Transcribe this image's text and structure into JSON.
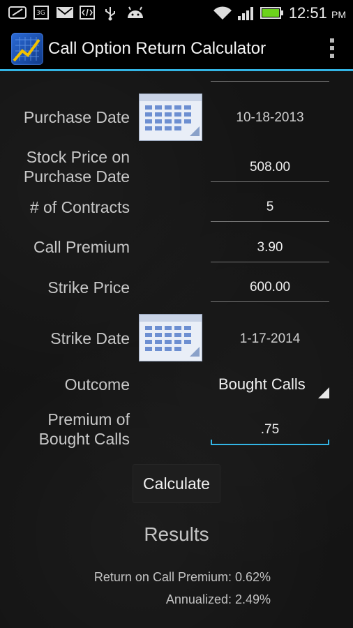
{
  "status_bar": {
    "time": "12:51",
    "ampm": "PM",
    "icons": [
      "no-sync-icon",
      "3g-icon",
      "gmail-icon",
      "code-icon",
      "usb-icon",
      "android-icon",
      "wifi-icon",
      "signal-icon",
      "battery-icon"
    ]
  },
  "app": {
    "title": "Call Option Return Calculator",
    "accent": "#33b5e5"
  },
  "form": {
    "purchase_date_label": "Purchase Date",
    "purchase_date_value": "10-18-2013",
    "stock_price_label_line1": "Stock Price on",
    "stock_price_label_line2": "Purchase Date",
    "stock_price_value": "508.00",
    "contracts_label": "# of Contracts",
    "contracts_value": "5",
    "call_premium_label": "Call Premium",
    "call_premium_value": "3.90",
    "strike_price_label": "Strike Price",
    "strike_price_value": "600.00",
    "strike_date_label": "Strike Date",
    "strike_date_value": "1-17-2014",
    "outcome_label": "Outcome",
    "outcome_value": "Bought Calls",
    "bought_premium_label_line1": "Premium of",
    "bought_premium_label_line2": "Bought Calls",
    "bought_premium_value": ".75"
  },
  "calculate_label": "Calculate",
  "results": {
    "heading": "Results",
    "return_on_premium": "Return on Call Premium: 0.62%",
    "annualized": "Annualized: 2.49%"
  }
}
